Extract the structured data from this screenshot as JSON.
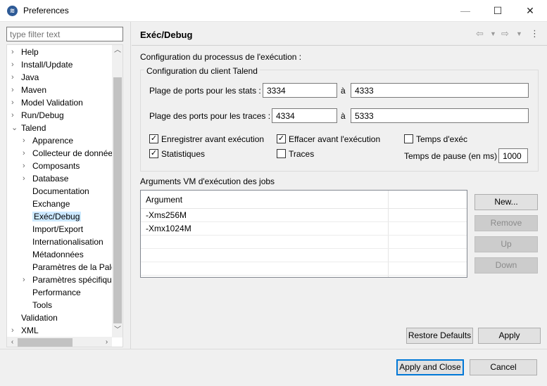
{
  "window": {
    "title": "Preferences"
  },
  "filter": {
    "placeholder": "type filter text"
  },
  "tree": [
    {
      "label": "Help",
      "expander": "›"
    },
    {
      "label": "Install/Update",
      "expander": "›"
    },
    {
      "label": "Java",
      "expander": "›"
    },
    {
      "label": "Maven",
      "expander": "›"
    },
    {
      "label": "Model Validation",
      "expander": "›"
    },
    {
      "label": "Run/Debug",
      "expander": "›"
    },
    {
      "label": "Talend",
      "expander": "⌄"
    },
    {
      "label": "Apparence",
      "expander": "›"
    },
    {
      "label": "Collecteur de donnée",
      "expander": "›"
    },
    {
      "label": "Composants",
      "expander": "›"
    },
    {
      "label": "Database",
      "expander": "›"
    },
    {
      "label": "Documentation",
      "expander": ""
    },
    {
      "label": "Exchange",
      "expander": ""
    },
    {
      "label": "Exéc/Debug",
      "expander": ""
    },
    {
      "label": "Import/Export",
      "expander": ""
    },
    {
      "label": "Internationalisation",
      "expander": ""
    },
    {
      "label": "Métadonnées",
      "expander": ""
    },
    {
      "label": "Paramètres de la Pale",
      "expander": ""
    },
    {
      "label": "Paramètres spécifique",
      "expander": "›"
    },
    {
      "label": "Performance",
      "expander": ""
    },
    {
      "label": "Tools",
      "expander": ""
    },
    {
      "label": "Validation",
      "expander": ""
    },
    {
      "label": "XML",
      "expander": "›"
    }
  ],
  "page": {
    "title": "Exéc/Debug",
    "process_label": "Configuration du processus de l'exécution :",
    "client_group": "Configuration du client Talend",
    "stats_label": "Plage de ports pour les stats :",
    "stats_from": "3334",
    "stats_to": "4333",
    "traces_label": "Plage des ports pour les traces :",
    "traces_from": "4334",
    "traces_to": "5333",
    "a_label": "à",
    "checkboxes": {
      "save_before": {
        "label": "Enregistrer avant exécution",
        "checked": true
      },
      "clear_before": {
        "label": "Effacer avant l'exécution",
        "checked": true
      },
      "exec_time": {
        "label": "Temps d'exéc",
        "checked": false
      },
      "statistics": {
        "label": "Statistiques",
        "checked": true
      },
      "traces": {
        "label": "Traces",
        "checked": false
      }
    },
    "pause_label": "Temps de pause (en ms)",
    "pause_value": "1000",
    "vm_args_label": "Arguments VM d'exécution des jobs",
    "table_header": "Argument",
    "vm_args": [
      "-Xms256M",
      "-Xmx1024M"
    ]
  },
  "buttons": {
    "new": "New...",
    "remove": "Remove",
    "up": "Up",
    "down": "Down",
    "restore_defaults": "Restore Defaults",
    "apply": "Apply",
    "apply_close": "Apply and Close",
    "cancel": "Cancel"
  },
  "window_controls": {
    "minimize": "—",
    "maximize": "☐",
    "close": "✕"
  }
}
